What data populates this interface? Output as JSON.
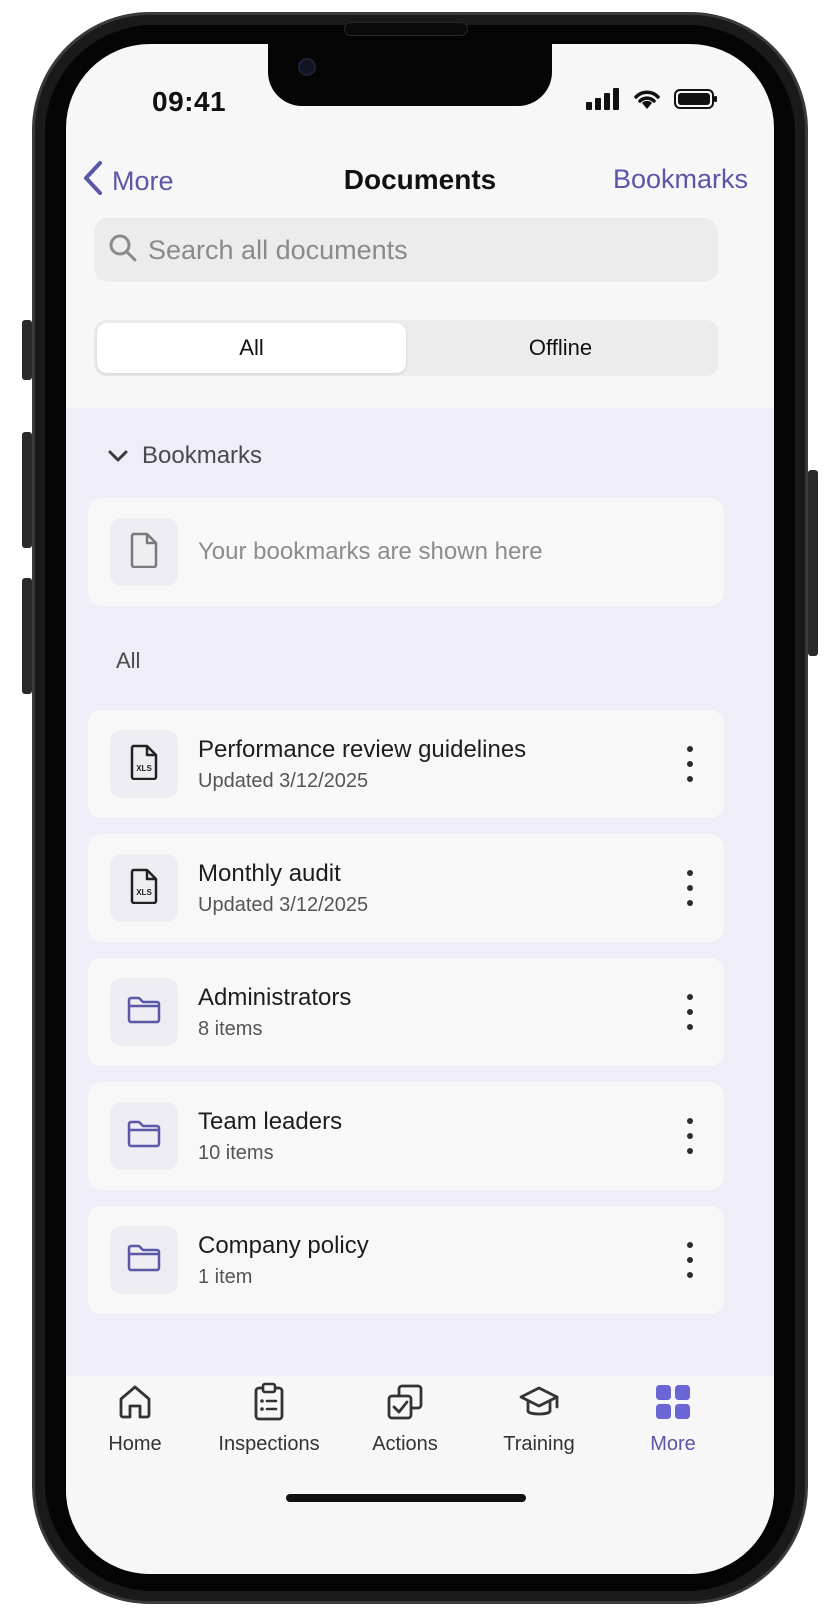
{
  "status_bar": {
    "time": "09:41"
  },
  "nav": {
    "back_label": "More",
    "title": "Documents",
    "action_label": "Bookmarks"
  },
  "search": {
    "placeholder": "Search all documents",
    "value": ""
  },
  "segmented": {
    "options": [
      "All",
      "Offline"
    ],
    "selected": "All"
  },
  "bookmarks": {
    "header": "Bookmarks",
    "empty_text": "Your bookmarks are shown here"
  },
  "all_section": {
    "header": "All",
    "items": [
      {
        "title": "Performance review guidelines",
        "subtitle": "Updated 3/12/2025",
        "icon": "xls-file-icon"
      },
      {
        "title": "Monthly audit",
        "subtitle": "Updated 3/12/2025",
        "icon": "xls-file-icon"
      },
      {
        "title": "Administrators",
        "subtitle": "8 items",
        "icon": "folder-icon"
      },
      {
        "title": "Team leaders",
        "subtitle": "10 items",
        "icon": "folder-icon"
      },
      {
        "title": "Company policy",
        "subtitle": "1 item",
        "icon": "folder-icon"
      }
    ]
  },
  "tab_bar": {
    "tabs": [
      {
        "label": "Home",
        "icon": "home-icon"
      },
      {
        "label": "Inspections",
        "icon": "clipboard-icon"
      },
      {
        "label": "Actions",
        "icon": "actions-icon"
      },
      {
        "label": "Training",
        "icon": "graduation-cap-icon"
      },
      {
        "label": "More",
        "icon": "grid-icon"
      }
    ],
    "active": "More"
  },
  "colors": {
    "accent": "#5a56a8",
    "accent_icon": "#6a66d6",
    "list_background": "#eeedf8",
    "card_background": "#f9f8f9"
  }
}
